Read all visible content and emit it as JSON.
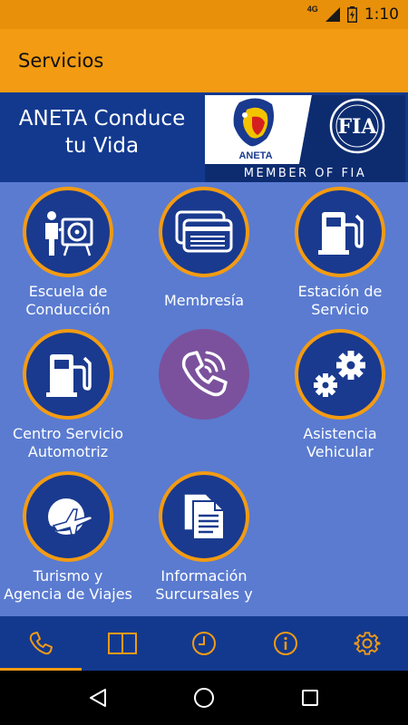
{
  "status_bar": {
    "network": "4G",
    "time": "1:10"
  },
  "app_bar": {
    "title": "Servicios"
  },
  "banner": {
    "line1": "ANETA Conduce",
    "line2": "tu Vida",
    "logo_text": "ANETA",
    "fia_text": "FIA",
    "fia_caption": "MEMBER OF FIA"
  },
  "services": [
    {
      "line1": "Escuela de",
      "line2": "Conducción",
      "icon": "driving-school-icon"
    },
    {
      "line1": "Membresía",
      "line2": "",
      "icon": "membership-cards-icon"
    },
    {
      "line1": "Estación de",
      "line2": "Servicio",
      "icon": "fuel-station-icon"
    },
    {
      "line1": "Centro Servicio",
      "line2": "Automotriz",
      "icon": "fuel-station-icon"
    },
    {
      "line1": "",
      "line2": "",
      "icon": "viber-phone-icon"
    },
    {
      "line1": "Asistencia",
      "line2": "Vehicular",
      "icon": "gears-icon"
    },
    {
      "line1": "Turismo y",
      "line2": "Agencia de Viajes",
      "icon": "globe-plane-icon"
    },
    {
      "line1": "Información",
      "line2": "Surcursales y",
      "icon": "documents-icon"
    }
  ],
  "bottom_nav": [
    "phone-icon",
    "book-icon",
    "clock-icon",
    "info-icon",
    "settings-icon"
  ],
  "colors": {
    "accent": "#f39b12",
    "primary": "#13398f",
    "background": "#5a7bd0",
    "viber": "#7b519d"
  }
}
